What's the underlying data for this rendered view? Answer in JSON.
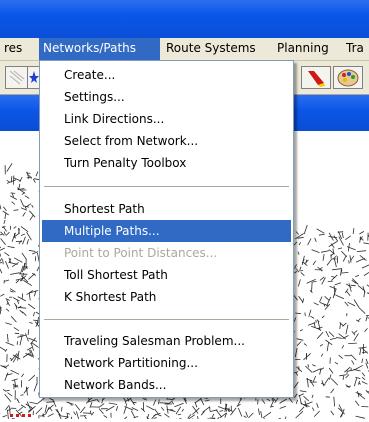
{
  "menubar": {
    "items": [
      {
        "label": "res"
      },
      {
        "label": "Networks/Paths"
      },
      {
        "label": "Route Systems"
      },
      {
        "label": "Planning"
      },
      {
        "label": "Tra"
      }
    ]
  },
  "networks_menu": {
    "items": [
      {
        "label": "Create...",
        "state": "normal"
      },
      {
        "label": "Settings...",
        "state": "normal"
      },
      {
        "label": "Link Directions...",
        "state": "normal"
      },
      {
        "label": "Select from Network...",
        "state": "normal"
      },
      {
        "label": "Turn Penalty Toolbox",
        "state": "normal"
      },
      {
        "label": "Shortest Path",
        "state": "normal"
      },
      {
        "label": "Multiple Paths...",
        "state": "highlighted"
      },
      {
        "label": "Point to Point Distances...",
        "state": "disabled"
      },
      {
        "label": "Toll Shortest Path",
        "state": "normal"
      },
      {
        "label": "K Shortest Path",
        "state": "normal"
      },
      {
        "label": "Traveling Salesman Problem...",
        "state": "normal"
      },
      {
        "label": "Network Partitioning...",
        "state": "normal"
      },
      {
        "label": "Network Bands...",
        "state": "normal"
      }
    ]
  },
  "toolbar": {
    "icons": [
      "select-tool-icon",
      "star-select-icon",
      "highlighter-icon",
      "color-palette-icon"
    ]
  },
  "colors": {
    "title_blue": "#0a56e8",
    "menu_highlight": "#316ac5",
    "disabled_text": "#aca899",
    "map_network": "#2b2b2b"
  }
}
